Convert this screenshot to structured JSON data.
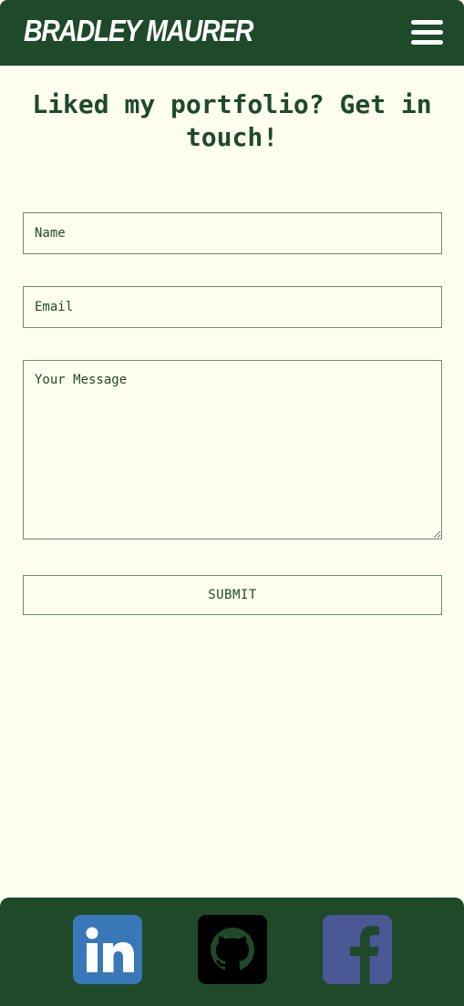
{
  "header": {
    "brand": "BRADLEY MAURER",
    "menu_icon": "hamburger-menu-icon"
  },
  "contact": {
    "title": "Liked my portfolio? Get in touch!",
    "name_placeholder": "Name",
    "email_placeholder": "Email",
    "message_placeholder": "Your Message",
    "submit_label": "SUBMIT"
  },
  "footer": {
    "social": [
      {
        "name": "LinkedIn",
        "icon": "linkedin-icon",
        "color": "#3878b8"
      },
      {
        "name": "GitHub",
        "icon": "github-icon",
        "color": "#000000"
      },
      {
        "name": "Facebook",
        "icon": "facebook-icon",
        "color": "#4a5896"
      }
    ]
  },
  "colors": {
    "primary": "#1e4a2a",
    "background": "#fefef0",
    "border": "#6f8a74"
  }
}
